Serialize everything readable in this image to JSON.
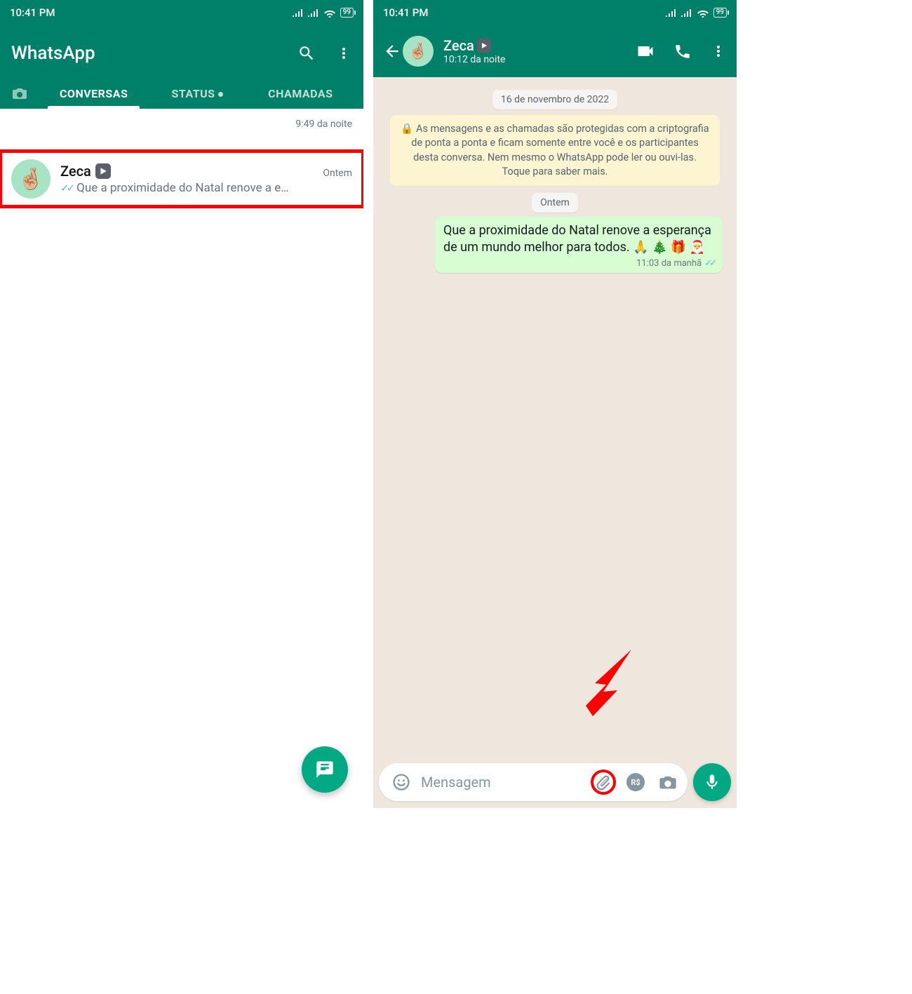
{
  "statusbar": {
    "time": "10:41 PM",
    "battery": "99"
  },
  "left": {
    "app_title": "WhatsApp",
    "tabs": {
      "conversas": "CONVERSAS",
      "status": "STATUS",
      "chamadas": "CHAMADAS"
    },
    "partial_row": {
      "time": "9:49 da noite"
    },
    "chat": {
      "name": "Zeca",
      "time": "Ontem",
      "preview": "Que a proximidade do Natal renove a e…"
    }
  },
  "right": {
    "header": {
      "name": "Zeca",
      "subtitle": "10:12 da noite"
    },
    "date_pill": "16 de novembro de 2022",
    "encryption_notice": "🔒 As mensagens e as chamadas são protegidas com a criptografia de ponta a ponta e ficam somente entre você e os participantes desta conversa. Nem mesmo o WhatsApp pode ler ou ouvi-las. Toque para saber mais.",
    "ontem_pill": "Ontem",
    "message": {
      "text": "Que a proximidade do Natal renove a esperança de um mundo melhor para todos. 🙏 🎄 🎁 🎅",
      "time": "11:03 da manhã"
    },
    "input_placeholder": "Mensagem",
    "payment_label": "R$"
  }
}
